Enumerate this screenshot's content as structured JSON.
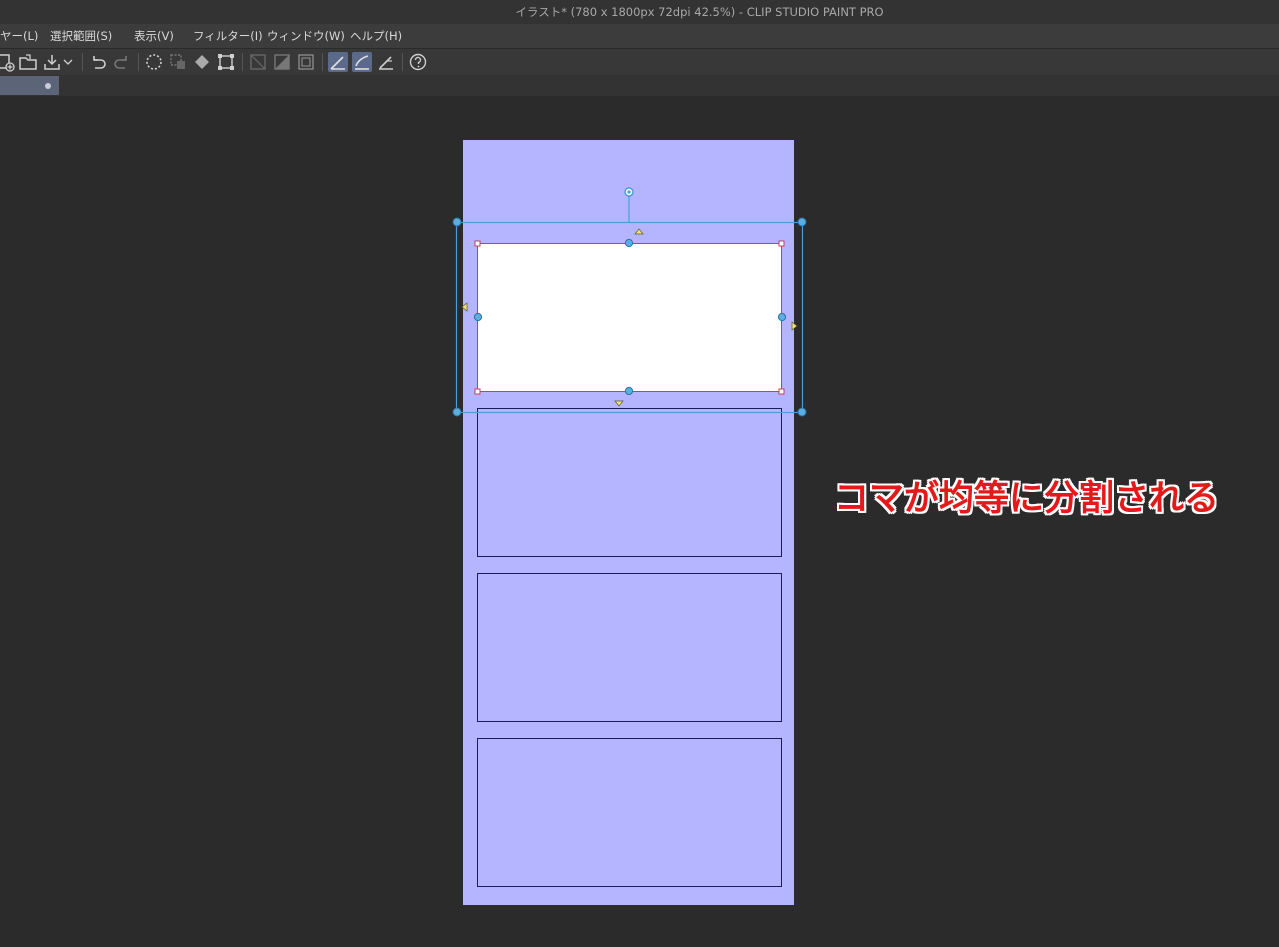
{
  "window": {
    "title": "イラスト* (780 x 1800px 72dpi 42.5%)  - CLIP STUDIO PAINT PRO"
  },
  "menu": {
    "items": [
      {
        "label": "ヤー(L)"
      },
      {
        "label": "選択範囲(S)"
      },
      {
        "label": "表示(V)"
      },
      {
        "label": "フィルター(I)"
      },
      {
        "label": "ウィンドウ(W)"
      },
      {
        "label": "ヘルプ(H)"
      }
    ]
  },
  "toolbar": {
    "icons": [
      "new-canvas-icon",
      "open-folder-icon",
      "save-icon",
      "dropdown-chevron-icon",
      "undo-icon",
      "redo-icon",
      "clear-selection-icon",
      "crop-selection-icon",
      "fill-icon",
      "transform-icon",
      "border-icon-1",
      "border-icon-2",
      "border-icon-3",
      "ruler-snap-icon",
      "special-ruler-snap-icon",
      "grid-snap-icon",
      "help-icon"
    ]
  },
  "tabs": [
    {
      "label": "",
      "modified": true
    }
  ],
  "canvas": {
    "paper_color": "#b4b4ff",
    "panel_border_color": "#1c1c5a",
    "selected_panel_border_color": "#d03a5a",
    "handle_color": "#4a9fd8",
    "panel_count": 4,
    "selected_panel_index": 0
  },
  "annotation": {
    "text": "コマが均等に分割される",
    "color": "#e41a1a"
  }
}
